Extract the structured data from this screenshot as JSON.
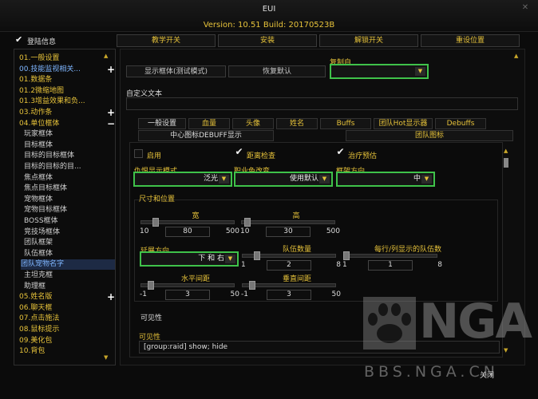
{
  "window": {
    "title": "EUI",
    "version": "Version: 10.51 Build: 20170523B",
    "close_label": "关闭"
  },
  "top": {
    "login_info_label": "登陆信息",
    "buttons": [
      "教学开关",
      "安装",
      "解锁开关",
      "重设位置"
    ]
  },
  "sidebar": {
    "items": [
      {
        "label": "01.一般设置",
        "type": "main"
      },
      {
        "label": "00.技能监视相关...",
        "type": "main",
        "plus": "+",
        "color": "#7fb6ff"
      },
      {
        "label": "01.数据条",
        "type": "main"
      },
      {
        "label": "01.2微缩地图",
        "type": "main"
      },
      {
        "label": "01.3增益效果和负...",
        "type": "main"
      },
      {
        "label": "03.动作条",
        "type": "main",
        "plus": "+"
      },
      {
        "label": "04.单位框体",
        "type": "main",
        "plus": "−"
      },
      {
        "label": "玩家框体",
        "type": "sub"
      },
      {
        "label": "目标框体",
        "type": "sub"
      },
      {
        "label": "目标的目标框体",
        "type": "sub"
      },
      {
        "label": "目标的目标的目...",
        "type": "sub"
      },
      {
        "label": "焦点框体",
        "type": "sub"
      },
      {
        "label": "焦点目标框体",
        "type": "sub"
      },
      {
        "label": "宠物框体",
        "type": "sub"
      },
      {
        "label": "宠物目标框体",
        "type": "sub"
      },
      {
        "label": "BOSS框体",
        "type": "sub"
      },
      {
        "label": "竞技场框体",
        "type": "sub"
      },
      {
        "label": "团队框架",
        "type": "sub"
      },
      {
        "label": "队伍框体",
        "type": "sub"
      },
      {
        "label": "团队宠物名字",
        "type": "sub",
        "selected": true
      },
      {
        "label": "主坦克框",
        "type": "sub"
      },
      {
        "label": "助理框",
        "type": "sub"
      },
      {
        "label": "05.姓名版",
        "type": "main",
        "plus": "+"
      },
      {
        "label": "06.聊天框",
        "type": "main"
      },
      {
        "label": "07.点击施法",
        "type": "main"
      },
      {
        "label": "08.鼠标提示",
        "type": "main"
      },
      {
        "label": "09.美化包",
        "type": "main"
      },
      {
        "label": "10.背包",
        "type": "main"
      }
    ]
  },
  "main": {
    "show_frame_button": "显示框体(测试模式)",
    "restore_default_button": "恢复默认",
    "copy_from_label": "复制自",
    "copy_from_value": "",
    "custom_text_label": "自定义文本",
    "custom_text_value": "",
    "tabs_row1": [
      "一般设置",
      "血量",
      "头像",
      "姓名",
      "Buffs",
      "团队Hot显示器",
      "Debuffs"
    ],
    "tabs_row2": [
      "中心图标DEBUFF显示",
      "团队图标"
    ],
    "enable_label": "启用",
    "enable_checked": false,
    "range_check_label": "距离检查",
    "range_check_checked": true,
    "heal_predict_label": "治疗预估",
    "heal_predict_checked": true,
    "threat_label": "仇恨显示模式",
    "threat_value": "泛光",
    "role_icon_label": "职业色改变",
    "role_icon_value": "使用默认",
    "frame_dir_label": "框架方向",
    "frame_dir_value": "中",
    "size_section_label": "尺寸和位置",
    "width_label": "宽",
    "width_min": "10",
    "width_value": "80",
    "width_max": "500",
    "width_fraction": 0.14,
    "height_label": "高",
    "height_min": "10",
    "height_value": "30",
    "height_max": "500",
    "height_fraction": 0.04,
    "grow_dir_label": "延展方向",
    "grow_dir_value": "下 和 右",
    "group_count_label": "队伍数量",
    "group_count_min": "1",
    "group_count_value": "2",
    "group_count_max": "8",
    "group_count_fraction": 0.14,
    "per_row_label": "每行/列显示的队伍数",
    "per_row_min": "1",
    "per_row_value": "1",
    "per_row_max": "8",
    "per_row_fraction": 0.0,
    "hspacing_label": "水平间距",
    "hspacing_min": "-1",
    "hspacing_value": "3",
    "hspacing_max": "50",
    "hspacing_fraction": 0.08,
    "vspacing_label": "垂直间距",
    "vspacing_min": "-1",
    "vspacing_value": "3",
    "vspacing_max": "50",
    "vspacing_fraction": 0.08,
    "visibility_section_label": "可见性",
    "visibility_label": "可见性",
    "visibility_value": "[group:raid] show; hide"
  },
  "watermark": {
    "site": "BBS.NGA.CN"
  }
}
